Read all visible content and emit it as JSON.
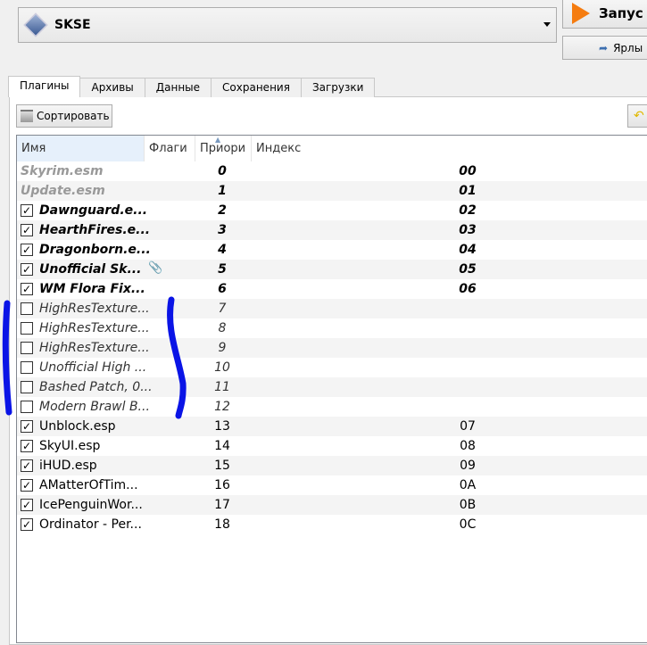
{
  "profile": {
    "label": "SKSE",
    "icon": "skse-icon"
  },
  "launch": {
    "label": "Запус"
  },
  "shortcut": {
    "label": "Ярлы"
  },
  "tabs": [
    {
      "label": "Плагины",
      "active": true
    },
    {
      "label": "Архивы"
    },
    {
      "label": "Данные"
    },
    {
      "label": "Сохранения"
    },
    {
      "label": "Загрузки"
    }
  ],
  "toolbar": {
    "sort_label": "Сортировать"
  },
  "columns": {
    "name": "Имя",
    "flags": "Флаги",
    "priority": "Приори",
    "index": "Индекс",
    "sorted": "priority"
  },
  "plugins": [
    {
      "name": "Skyrim.esm",
      "priority": "0",
      "index": "00",
      "checked": null,
      "type": "master"
    },
    {
      "name": "Update.esm",
      "priority": "1",
      "index": "01",
      "checked": null,
      "type": "master"
    },
    {
      "name": "Dawnguard.e...",
      "priority": "2",
      "index": "02",
      "checked": true,
      "type": "master"
    },
    {
      "name": "HearthFires.e...",
      "priority": "3",
      "index": "03",
      "checked": true,
      "type": "master"
    },
    {
      "name": "Dragonborn.e...",
      "priority": "4",
      "index": "04",
      "checked": true,
      "type": "master"
    },
    {
      "name": "Unofficial Sk...",
      "priority": "5",
      "index": "05",
      "checked": true,
      "type": "master",
      "flag": "attachment-icon"
    },
    {
      "name": "WM Flora Fix...",
      "priority": "6",
      "index": "06",
      "checked": true,
      "type": "master"
    },
    {
      "name": "HighResTexture...",
      "priority": "7",
      "index": "",
      "checked": false,
      "type": "inactive"
    },
    {
      "name": "HighResTexture...",
      "priority": "8",
      "index": "",
      "checked": false,
      "type": "inactive"
    },
    {
      "name": "HighResTexture...",
      "priority": "9",
      "index": "",
      "checked": false,
      "type": "inactive"
    },
    {
      "name": "Unofficial High ...",
      "priority": "10",
      "index": "",
      "checked": false,
      "type": "inactive"
    },
    {
      "name": "Bashed Patch, 0...",
      "priority": "11",
      "index": "",
      "checked": false,
      "type": "inactive"
    },
    {
      "name": "Modern Brawl B...",
      "priority": "12",
      "index": "",
      "checked": false,
      "type": "inactive"
    },
    {
      "name": "Unblock.esp",
      "priority": "13",
      "index": "07",
      "checked": true,
      "type": "plugin"
    },
    {
      "name": "SkyUI.esp",
      "priority": "14",
      "index": "08",
      "checked": true,
      "type": "plugin"
    },
    {
      "name": "iHUD.esp",
      "priority": "15",
      "index": "09",
      "checked": true,
      "type": "plugin"
    },
    {
      "name": "AMatterOfTim...",
      "priority": "16",
      "index": "0A",
      "checked": true,
      "type": "plugin"
    },
    {
      "name": "IcePenguinWor...",
      "priority": "17",
      "index": "0B",
      "checked": true,
      "type": "plugin"
    },
    {
      "name": "Ordinator - Per...",
      "priority": "18",
      "index": "0C",
      "checked": true,
      "type": "plugin"
    }
  ],
  "annotation_color": "#0a14e6"
}
